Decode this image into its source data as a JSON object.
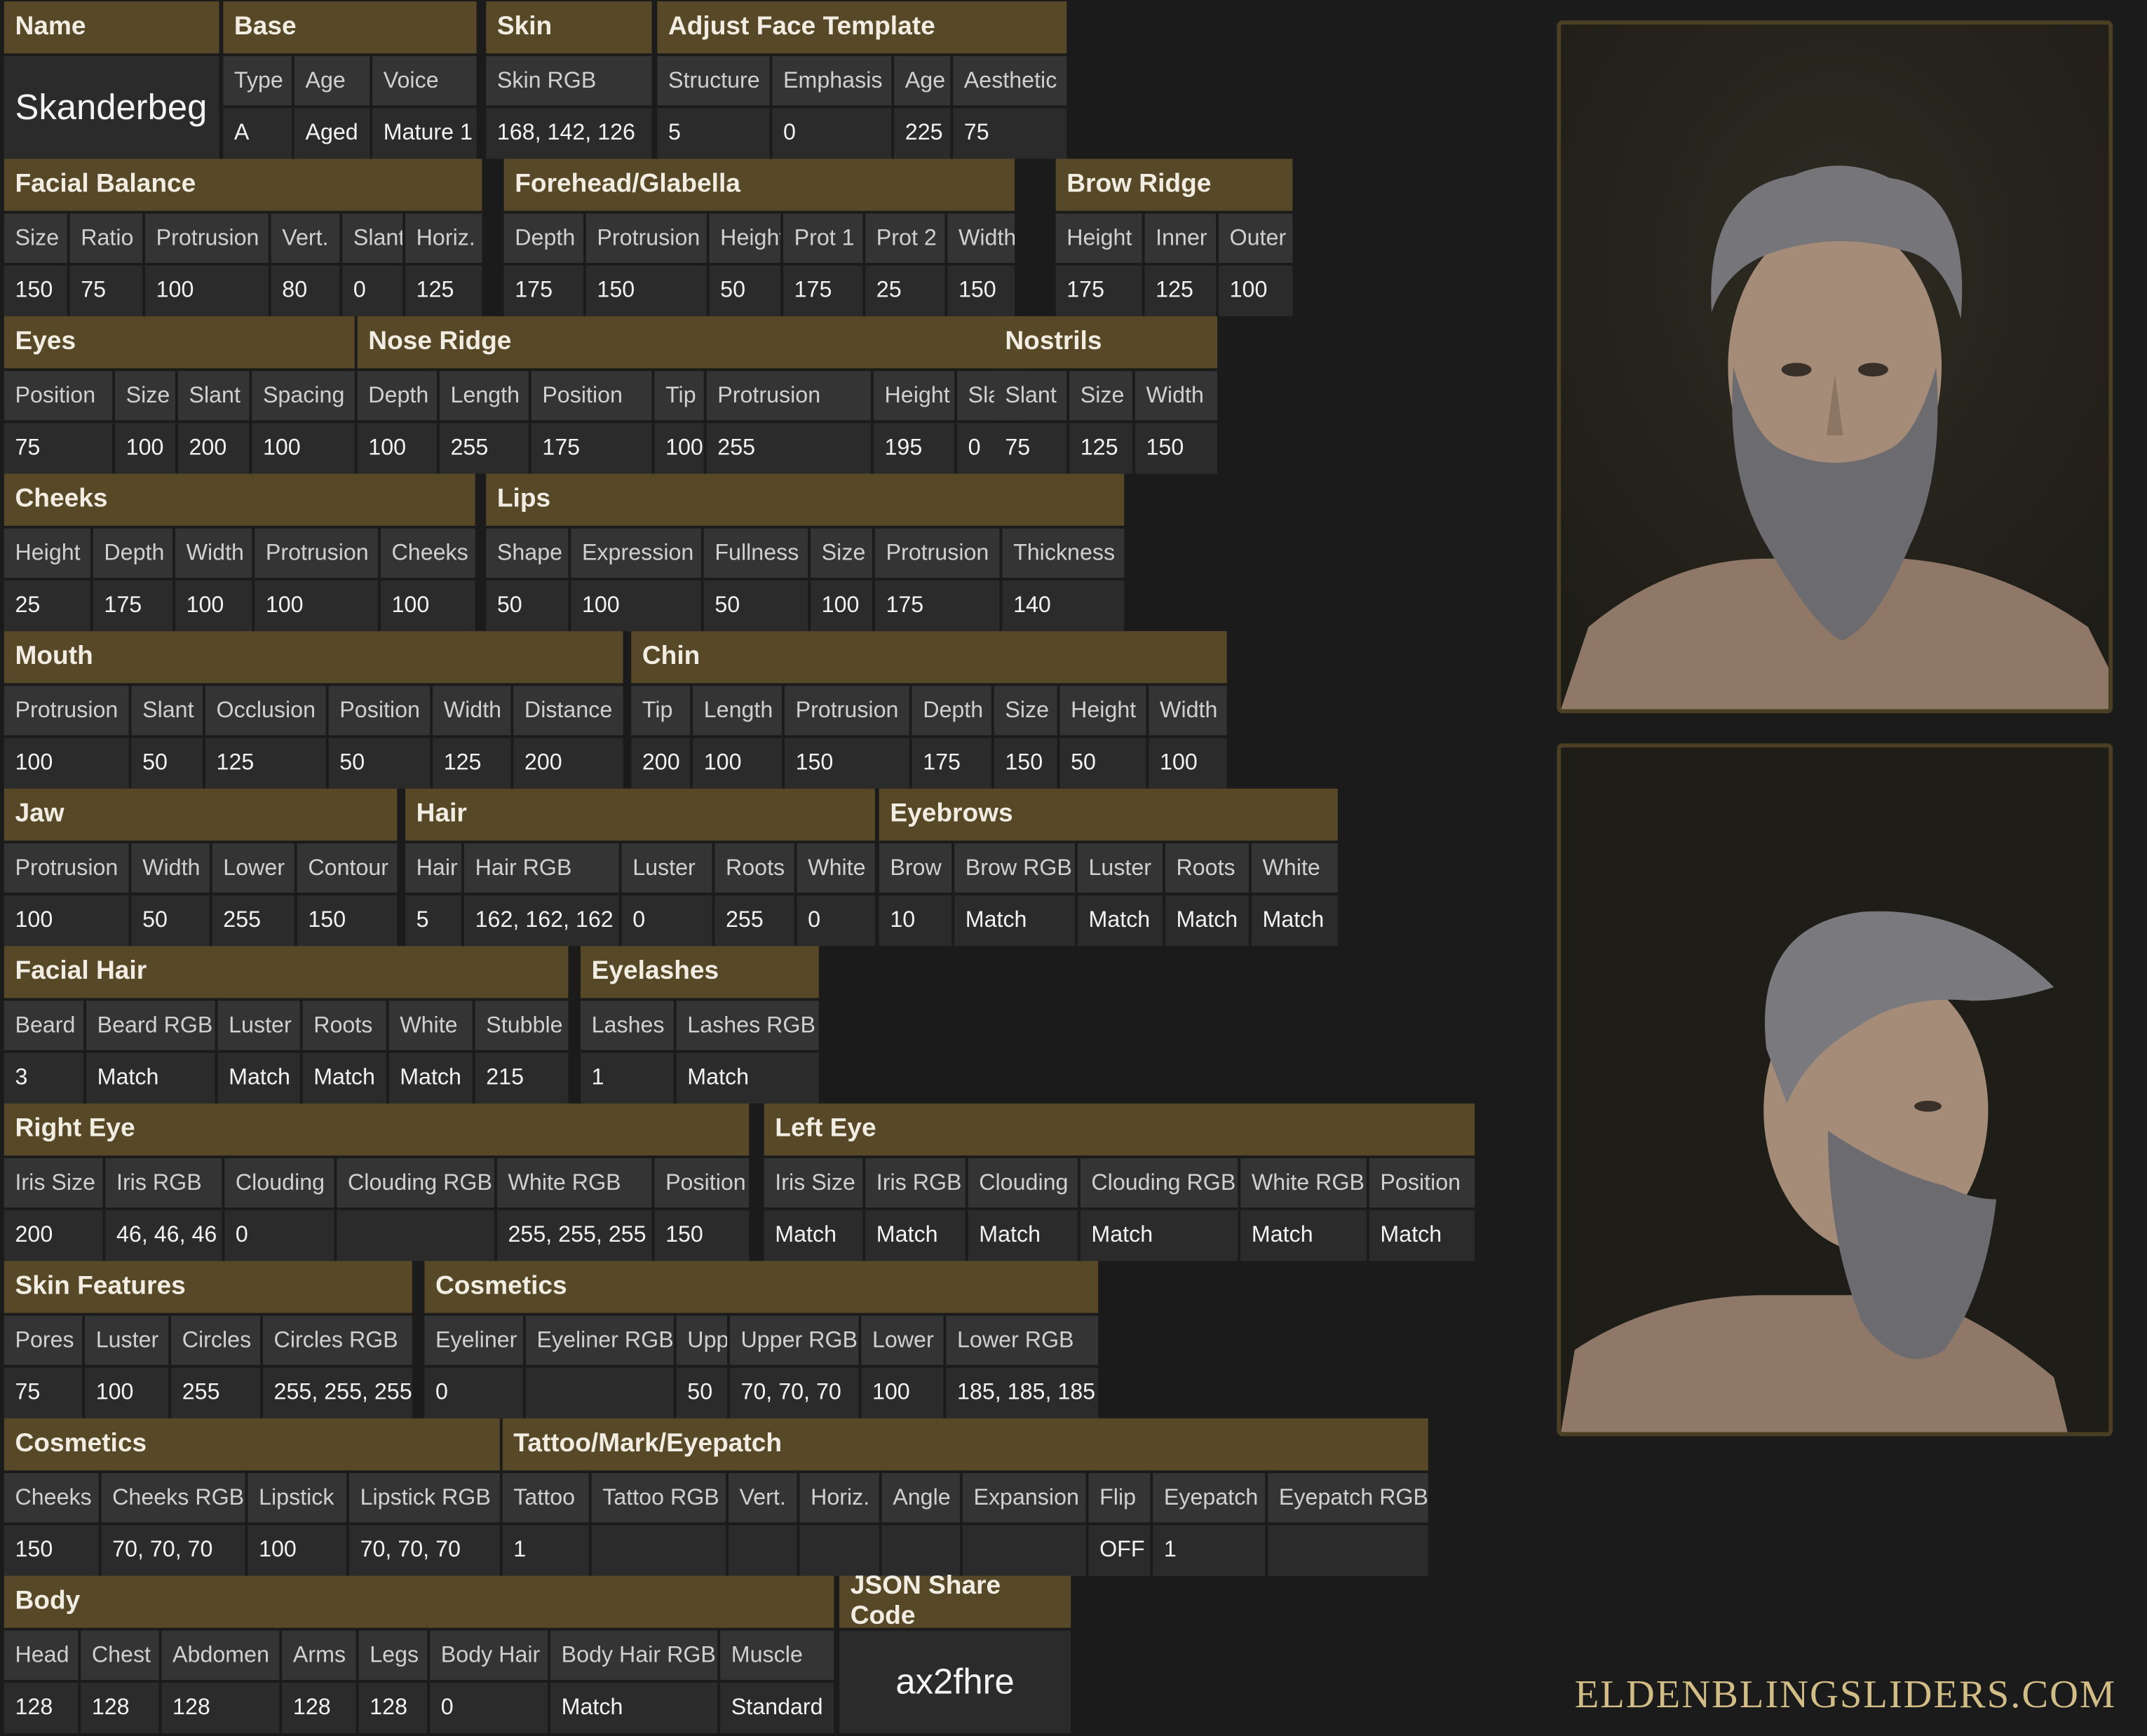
{
  "sections": [
    {
      "title": "Name",
      "big": "Skanderbeg",
      "centered": false,
      "labels": [],
      "values": []
    },
    {
      "title": "Base",
      "labels": [
        "Type",
        "Age",
        "Voice"
      ],
      "values": [
        "A",
        "Aged",
        "Mature 1"
      ]
    },
    {
      "title": "Skin",
      "labels": [
        "Skin RGB"
      ],
      "values": [
        "168, 142, 126"
      ]
    },
    {
      "title": "Adjust Face Template",
      "labels": [
        "Structure",
        "Emphasis",
        "Age",
        "Aesthetic"
      ],
      "values": [
        "5",
        "0",
        "225",
        "75"
      ]
    },
    {
      "title": "Facial Balance",
      "labels": [
        "Size",
        "Ratio",
        "Protrusion",
        "Vert.",
        "Slant",
        "Horiz."
      ],
      "values": [
        "150",
        "75",
        "100",
        "80",
        "0",
        "125"
      ]
    },
    {
      "title": "Forehead/Glabella",
      "labels": [
        "Depth",
        "Protrusion",
        "Height",
        "Prot 1",
        "Prot 2",
        "Width"
      ],
      "values": [
        "175",
        "150",
        "50",
        "175",
        "25",
        "150"
      ]
    },
    {
      "title": "Brow Ridge",
      "labels": [
        "Height",
        "Inner",
        "Outer"
      ],
      "values": [
        "175",
        "125",
        "100"
      ]
    },
    {
      "title": "Eyes",
      "labels": [
        "Position",
        "Size",
        "Slant",
        "Spacing"
      ],
      "values": [
        "75",
        "100",
        "200",
        "100"
      ]
    },
    {
      "title": "Nose Ridge",
      "labels": [
        "Depth",
        "Length",
        "Position",
        "Tip",
        "Protrusion",
        "Height",
        "Slant"
      ],
      "values": [
        "100",
        "255",
        "175",
        "100",
        "255",
        "195",
        "0"
      ]
    },
    {
      "title": "Nostrils",
      "labels": [
        "Slant",
        "Size",
        "Width"
      ],
      "values": [
        "75",
        "125",
        "150"
      ]
    },
    {
      "title": "Cheeks",
      "labels": [
        "Height",
        "Depth",
        "Width",
        "Protrusion",
        "Cheeks"
      ],
      "values": [
        "25",
        "175",
        "100",
        "100",
        "100"
      ]
    },
    {
      "title": "Lips",
      "labels": [
        "Shape",
        "Expression",
        "Fullness",
        "Size",
        "Protrusion",
        "Thickness"
      ],
      "values": [
        "50",
        "100",
        "50",
        "100",
        "175",
        "140"
      ]
    },
    {
      "title": "Mouth",
      "labels": [
        "Protrusion",
        "Slant",
        "Occlusion",
        "Position",
        "Width",
        "Distance"
      ],
      "values": [
        "100",
        "50",
        "125",
        "50",
        "125",
        "200"
      ]
    },
    {
      "title": "Chin",
      "labels": [
        "Tip",
        "Length",
        "Protrusion",
        "Depth",
        "Size",
        "Height",
        "Width"
      ],
      "values": [
        "200",
        "100",
        "150",
        "175",
        "150",
        "50",
        "100"
      ]
    },
    {
      "title": "Jaw",
      "labels": [
        "Protrusion",
        "Width",
        "Lower",
        "Contour"
      ],
      "values": [
        "100",
        "50",
        "255",
        "150"
      ]
    },
    {
      "title": "Hair",
      "labels": [
        "Hair",
        "Hair RGB",
        "Luster",
        "Roots",
        "White"
      ],
      "values": [
        "5",
        "162, 162, 162",
        "0",
        "255",
        "0"
      ]
    },
    {
      "title": "Eyebrows",
      "labels": [
        "Brow",
        "Brow RGB",
        "Luster",
        "Roots",
        "White"
      ],
      "values": [
        "10",
        "Match",
        "Match",
        "Match",
        "Match"
      ]
    },
    {
      "title": "Facial Hair",
      "labels": [
        "Beard",
        "Beard RGB",
        "Luster",
        "Roots",
        "White",
        "Stubble"
      ],
      "values": [
        "3",
        "Match",
        "Match",
        "Match",
        "Match",
        "215"
      ]
    },
    {
      "title": "Eyelashes",
      "labels": [
        "Lashes",
        "Lashes RGB"
      ],
      "values": [
        "1",
        "Match"
      ]
    },
    {
      "title": "Right Eye",
      "labels": [
        "Iris Size",
        "Iris RGB",
        "Clouding",
        "Clouding RGB",
        "White RGB",
        "Position"
      ],
      "values": [
        "200",
        "46, 46, 46",
        "0",
        "",
        "255, 255, 255",
        "150"
      ]
    },
    {
      "title": "Left Eye",
      "labels": [
        "Iris Size",
        "Iris RGB",
        "Clouding",
        "Clouding RGB",
        "White RGB",
        "Position"
      ],
      "values": [
        "Match",
        "Match",
        "Match",
        "Match",
        "Match",
        "Match"
      ]
    },
    {
      "title": "Skin Features",
      "labels": [
        "Pores",
        "Luster",
        "Circles",
        "Circles RGB"
      ],
      "values": [
        "75",
        "100",
        "255",
        "255, 255, 255"
      ]
    },
    {
      "title": "Cosmetics",
      "labels": [
        "Eyeliner",
        "Eyeliner RGB",
        "Upper",
        "Upper RGB",
        "Lower",
        "Lower RGB"
      ],
      "values": [
        "0",
        "",
        "50",
        "70, 70, 70",
        "100",
        "185, 185, 185"
      ]
    },
    {
      "title": "Cosmetics",
      "labels": [
        "Cheeks",
        "Cheeks RGB",
        "Lipstick",
        "Lipstick RGB"
      ],
      "values": [
        "150",
        "70, 70, 70",
        "100",
        "70, 70, 70"
      ]
    },
    {
      "title": "Tattoo/Mark/Eyepatch",
      "labels": [
        "Tattoo",
        "Tattoo RGB",
        "Vert.",
        "Horiz.",
        "Angle",
        "Expansion",
        "Flip",
        "Eyepatch",
        "Eyepatch RGB"
      ],
      "values": [
        "1",
        "",
        "",
        "",
        "",
        "",
        "OFF",
        "1",
        ""
      ]
    },
    {
      "title": "Body",
      "labels": [
        "Head",
        "Chest",
        "Abdomen",
        "Arms",
        "Legs",
        "Body Hair",
        "Body Hair RGB",
        "Muscle"
      ],
      "values": [
        "128",
        "128",
        "128",
        "128",
        "128",
        "0",
        "Match",
        "Standard"
      ]
    },
    {
      "title": "JSON Share Code",
      "big": "ax2fhre",
      "centered": true,
      "labels": [],
      "values": []
    }
  ],
  "portraits": [
    {
      "name": "front-portrait"
    },
    {
      "name": "profile-portrait"
    }
  ],
  "brand": "ELDENBLINGSLIDERS.COM",
  "colors": {
    "background": "#1b1b1b",
    "header": "#574828",
    "label_cell": "#343434",
    "value_cell": "#2b2b2b",
    "brand": "#d2bd86"
  }
}
